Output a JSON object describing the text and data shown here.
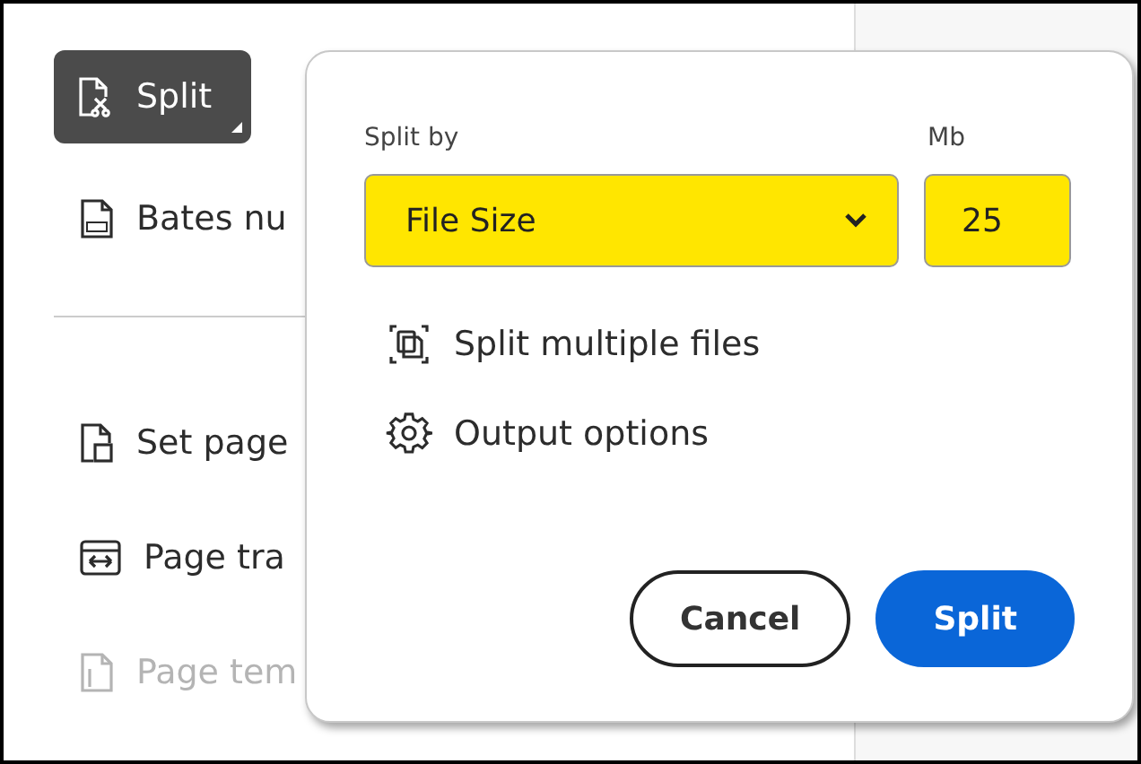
{
  "sidebar": {
    "items": [
      {
        "label": "Split",
        "selected": true,
        "disabled": false
      },
      {
        "label": "Bates nu",
        "selected": false,
        "disabled": false
      },
      {
        "label": "Set page",
        "selected": false,
        "disabled": false
      },
      {
        "label": "Page tra",
        "selected": false,
        "disabled": false
      },
      {
        "label": "Page tem",
        "selected": false,
        "disabled": true
      }
    ]
  },
  "popup": {
    "split_by": {
      "label": "Split by",
      "value": "File Size"
    },
    "size": {
      "label": "Mb",
      "value": "25"
    },
    "options": [
      "Split multiple files",
      "Output options"
    ],
    "buttons": [
      {
        "label": "Cancel",
        "kind": "secondary"
      },
      {
        "label": "Split",
        "kind": "primary"
      }
    ]
  }
}
